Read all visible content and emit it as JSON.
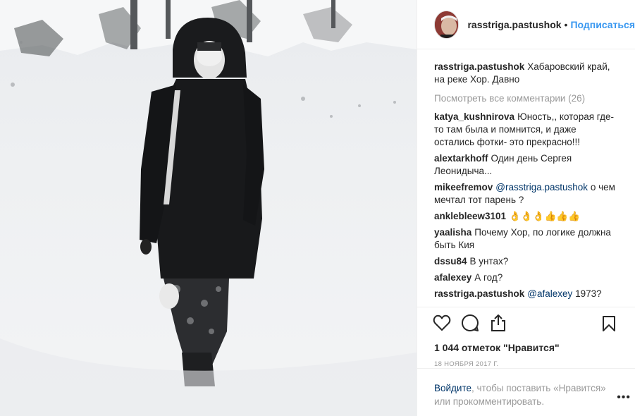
{
  "header": {
    "username": "rasstriga.pastushok",
    "separator": "•",
    "follow_label": "Подписаться"
  },
  "caption": {
    "username": "rasstriga.pastushok",
    "text": "Хабаровский край, на реке Хор. Давно"
  },
  "view_all_comments": "Посмотреть все комментарии (26)",
  "comments": [
    {
      "user": "katya_kushnirova",
      "mention": "",
      "text": "Юность,, которая где-то там была и помнится, и даже остались фотки- это прекрасно!!!"
    },
    {
      "user": "alextarkhoff",
      "mention": "",
      "text": "Один день Сергея Леонидыча..."
    },
    {
      "user": "mikeefremov",
      "mention": "@rasstriga.pastushok",
      "text": "о чем мечтал тот парень ?"
    },
    {
      "user": "anklebleew3101",
      "mention": "",
      "text": "👌👌👌👍👍👍"
    },
    {
      "user": "yaalisha",
      "mention": "",
      "text": "Почему Хор, по логике должна быть Кия"
    },
    {
      "user": "dssu84",
      "mention": "",
      "text": "В унтах?"
    },
    {
      "user": "afalexey",
      "mention": "",
      "text": "А год?"
    },
    {
      "user": "rasstriga.pastushok",
      "mention": "@afalexey",
      "text": "1973?"
    }
  ],
  "actions": {
    "like_icon": "heart-icon",
    "comment_icon": "comment-icon",
    "share_icon": "share-icon",
    "save_icon": "bookmark-icon"
  },
  "likes_text": "1 044 отметок \"Нравится\"",
  "date_text": "18 ноября 2017 г.",
  "login_prompt": {
    "link": "Войдите",
    "text": ", чтобы поставить «Нравится» или прокомментировать."
  },
  "more_options": "•••",
  "colors": {
    "accent": "#3897f0",
    "link": "#003569",
    "muted": "#999999",
    "text": "#262626"
  }
}
